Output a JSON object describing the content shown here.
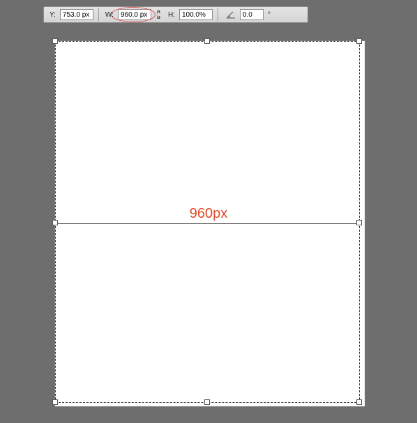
{
  "toolbar": {
    "y_label": "Y:",
    "y_value": "753.0 px",
    "w_label": "W:",
    "w_value": "960.0 px",
    "h_label": "H:",
    "h_value": "100.0%",
    "angle_value": "0.0",
    "angle_unit": "°"
  },
  "canvas": {
    "width_annotation": "960px"
  }
}
